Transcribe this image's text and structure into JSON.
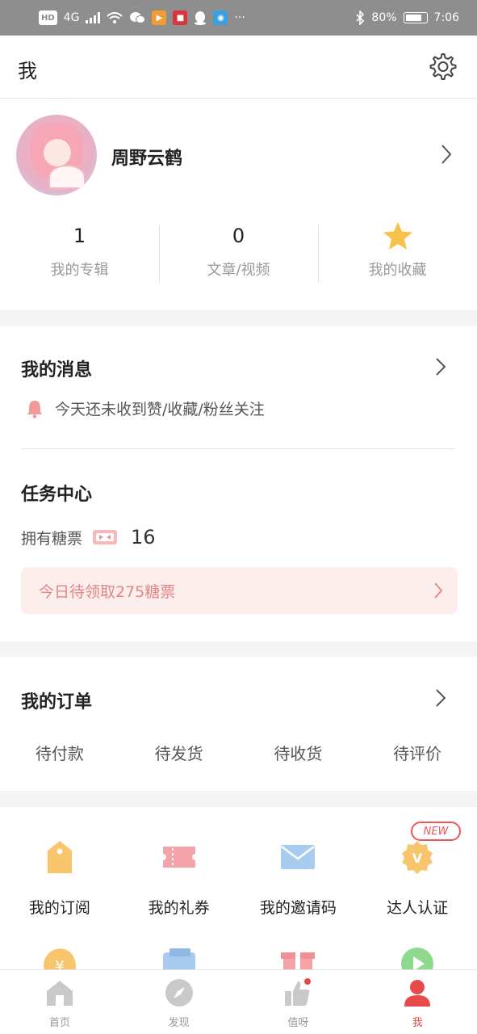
{
  "status_bar": {
    "left_badges": [
      "HD",
      "4G"
    ],
    "battery": "80%",
    "time": "7:06",
    "more": "···"
  },
  "header": {
    "title": "我",
    "settings_icon": "gear-icon"
  },
  "profile": {
    "username": "周野云鹤",
    "stats": [
      {
        "value": "1",
        "label": "我的专辑"
      },
      {
        "value": "0",
        "label": "文章/视频"
      },
      {
        "value": "",
        "label": "我的收藏",
        "icon": "star-icon"
      }
    ]
  },
  "messages": {
    "title": "我的消息",
    "note": "今天还未收到赞/收藏/粉丝关注"
  },
  "tasks": {
    "title": "任务中心",
    "tickets_label": "拥有糖票",
    "tickets_count": "16",
    "claim_text": "今日待领取275糖票"
  },
  "orders": {
    "title": "我的订单",
    "items": [
      "待付款",
      "待发货",
      "待收货",
      "待评价"
    ]
  },
  "grid": {
    "items": [
      {
        "label": "我的订阅",
        "icon": "tag-icon"
      },
      {
        "label": "我的礼券",
        "icon": "coupon-icon"
      },
      {
        "label": "我的邀请码",
        "icon": "envelope-icon"
      },
      {
        "label": "达人认证",
        "icon": "verified-badge-icon",
        "badge": "NEW"
      }
    ],
    "row2_icons": [
      "coin-exchange-icon",
      "wallet-icon",
      "gift-icon",
      "play-icon"
    ]
  },
  "tabbar": {
    "items": [
      {
        "label": "首页",
        "icon": "home-icon"
      },
      {
        "label": "发现",
        "icon": "compass-icon"
      },
      {
        "label": "值呀",
        "icon": "thumbs-up-icon"
      },
      {
        "label": "我",
        "icon": "person-icon",
        "active": true
      }
    ]
  },
  "colors": {
    "accent": "#e74a4a",
    "claim_bg": "#fdeeee",
    "star": "#f8c149",
    "icon_orange": "#f8c56d",
    "icon_pink": "#f4a3a8",
    "icon_blue": "#a8ccf0"
  }
}
